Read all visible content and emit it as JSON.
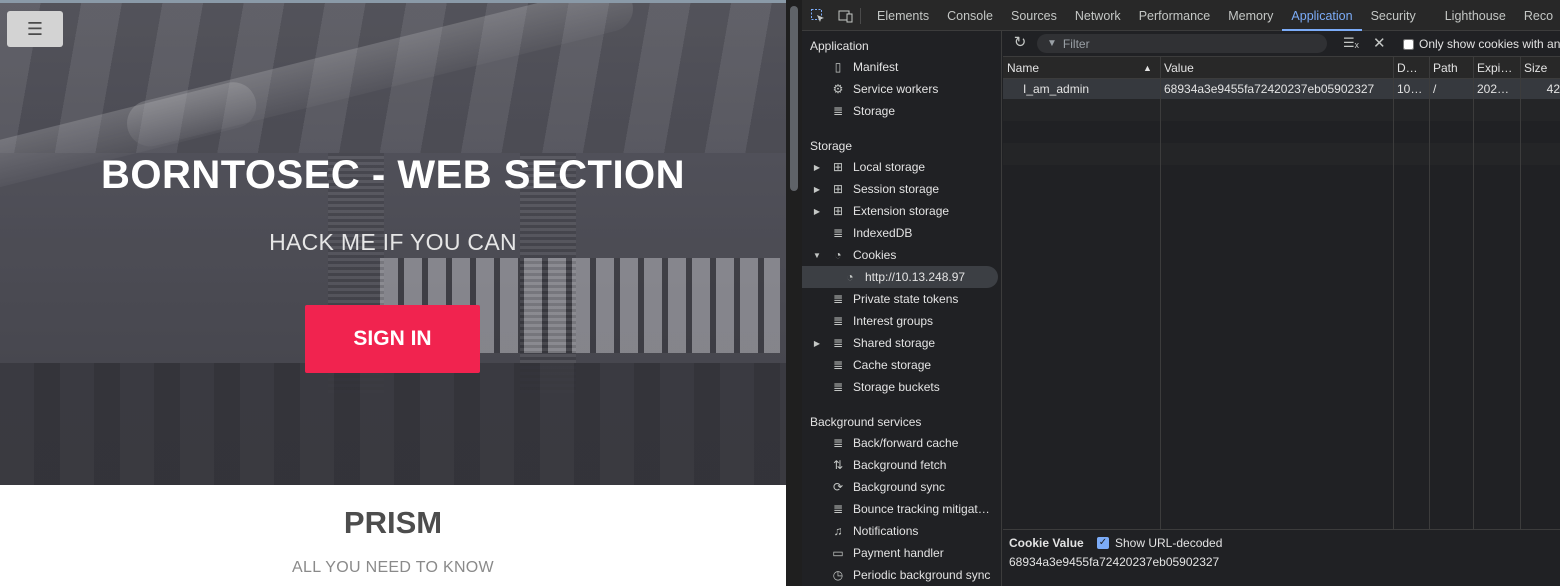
{
  "site": {
    "hero_title": "BORNTOSEC - WEB SECTION",
    "hero_subtitle": "HACK ME IF YOU CAN",
    "signin_label": "SIGN IN",
    "section_title": "PRISM",
    "section_subtitle": "ALL YOU NEED TO KNOW",
    "menu_icon": "☰",
    "accent": "#f1234f"
  },
  "devtools": {
    "tabs": [
      "Elements",
      "Console",
      "Sources",
      "Network",
      "Performance",
      "Memory",
      "Application",
      "Security",
      "Lighthouse",
      "Reco"
    ],
    "active_tab": "Application",
    "sidebar": {
      "application_header": "Application",
      "application_items": [
        {
          "label": "Manifest",
          "icon": "document-icon"
        },
        {
          "label": "Service workers",
          "icon": "gears-icon"
        },
        {
          "label": "Storage",
          "icon": "database-icon"
        }
      ],
      "storage_header": "Storage",
      "storage_items": [
        {
          "label": "Local storage",
          "icon": "table-icon",
          "expandable": true
        },
        {
          "label": "Session storage",
          "icon": "table-icon",
          "expandable": true
        },
        {
          "label": "Extension storage",
          "icon": "table-icon",
          "expandable": true
        },
        {
          "label": "IndexedDB",
          "icon": "database-icon"
        },
        {
          "label": "Cookies",
          "icon": "cookie-icon",
          "expanded": true
        },
        {
          "label": "http://10.13.248.97",
          "icon": "cookie-icon",
          "selected": true,
          "child": true
        },
        {
          "label": "Private state tokens",
          "icon": "database-icon"
        },
        {
          "label": "Interest groups",
          "icon": "database-icon"
        },
        {
          "label": "Shared storage",
          "icon": "database-icon",
          "expandable": true
        },
        {
          "label": "Cache storage",
          "icon": "database-icon"
        },
        {
          "label": "Storage buckets",
          "icon": "database-icon"
        }
      ],
      "background_header": "Background services",
      "background_items": [
        {
          "label": "Back/forward cache",
          "icon": "database-icon"
        },
        {
          "label": "Background fetch",
          "icon": "arrows-icon"
        },
        {
          "label": "Background sync",
          "icon": "sync-icon"
        },
        {
          "label": "Bounce tracking mitigat…",
          "icon": "database-icon"
        },
        {
          "label": "Notifications",
          "icon": "bell-icon"
        },
        {
          "label": "Payment handler",
          "icon": "card-icon"
        },
        {
          "label": "Periodic background sync",
          "icon": "clock-icon"
        }
      ]
    },
    "cookies": {
      "filter_placeholder": "Filter",
      "only_issues_label": "Only show cookies with an",
      "columns": [
        "Name",
        "Value",
        "D…",
        "Path",
        "Expi…",
        "Size"
      ],
      "rows": [
        {
          "name": "I_am_admin",
          "value": "68934a3e9455fa72420237eb05902327",
          "domain": "10…",
          "path": "/",
          "expires": "202…",
          "size": "42"
        }
      ],
      "detail": {
        "title": "Cookie Value",
        "decoded_label": "Show URL-decoded",
        "value": "68934a3e9455fa72420237eb05902327"
      }
    },
    "accent": "#7cacf8"
  }
}
